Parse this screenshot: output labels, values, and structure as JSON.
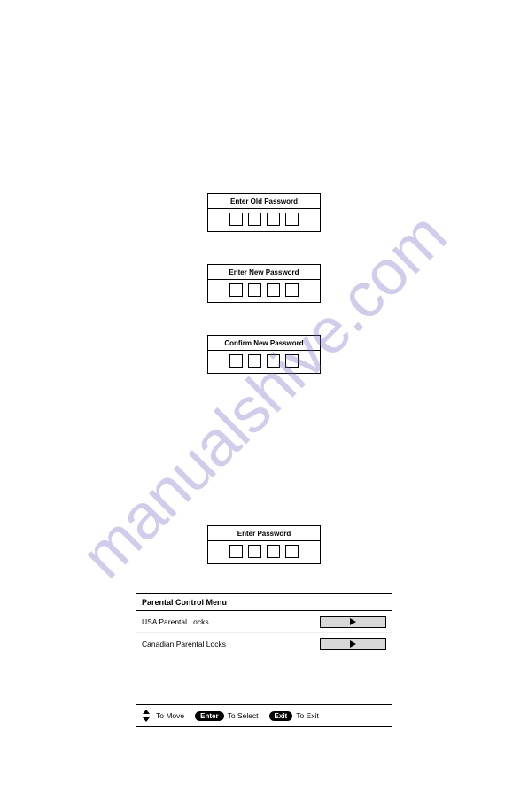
{
  "watermark": "manualshive.com",
  "password_boxes": {
    "old": "Enter Old Password",
    "new": "Enter New Password",
    "confirm": "Confirm New Password",
    "enter": "Enter  Password"
  },
  "menu": {
    "title": "Parental Control Menu",
    "rows": [
      {
        "label": "USA Parental Locks"
      },
      {
        "label": "Canadian Parental Locks"
      }
    ],
    "footer": {
      "move": "To Move",
      "enter_btn": "Enter",
      "select": "To Select",
      "exit_btn": "Exit",
      "exit": "To Exit"
    }
  }
}
